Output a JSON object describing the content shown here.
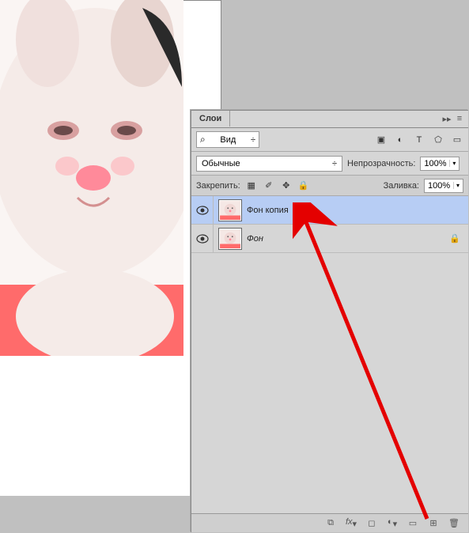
{
  "panel": {
    "tab_title": "Слои",
    "search_label": "Вид",
    "blend_mode": "Обычные",
    "opacity_label": "Непрозрачность:",
    "opacity_value": "100%",
    "lock_label": "Закрепить:",
    "fill_label": "Заливка:",
    "fill_value": "100%"
  },
  "layers": [
    {
      "name": "Фон копия",
      "locked": false,
      "selected": true
    },
    {
      "name": "Фон",
      "locked": true,
      "selected": false
    }
  ],
  "icons": {
    "search": "⌕",
    "kind_arrow": "÷",
    "image": "▣",
    "adjust": "◐",
    "text": "T",
    "shape": "⬠",
    "smart": "▭",
    "lock_pixels": "▦",
    "lock_brush": "✐",
    "lock_move": "✥",
    "lock_all": "🔒",
    "link": "⧉",
    "fx": "fx",
    "mask": "◻",
    "fill_adj": "◐",
    "group": "▭",
    "new": "⊞",
    "trash": "🗑",
    "menu_expand": "▸▸",
    "menu_options": "≡"
  }
}
